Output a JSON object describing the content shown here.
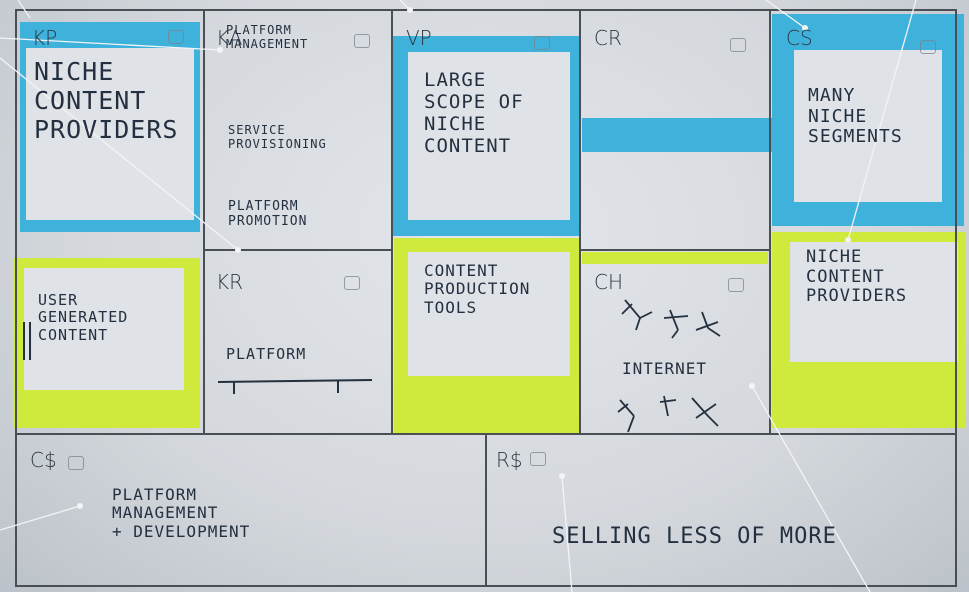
{
  "blocks": {
    "kp": {
      "code": "KP",
      "note": "Niche\nContent\nProviders"
    },
    "ka": {
      "code": "KA",
      "notes": [
        "Platform\nmanagement",
        "Service\nprovisioning",
        "Platform\npromotion"
      ]
    },
    "kr": {
      "code": "KR",
      "note": "Platform"
    },
    "vp": {
      "code": "VP",
      "notes": [
        "Large\nscope of\nniche\ncontent",
        "Content\nproduction\ntools"
      ]
    },
    "cr": {
      "code": "CR"
    },
    "ch": {
      "code": "CH",
      "note": "Internet"
    },
    "cs": {
      "code": "CS",
      "notes": [
        "Many\nniche\nsegments",
        "Niche\ncontent\nproviders"
      ]
    },
    "cost": {
      "code": "C$",
      "note": "Platform\nmanagement\n+ development"
    },
    "revenue": {
      "code": "R$",
      "note": "Selling less of MORE"
    },
    "user_generated": {
      "note": "User\ngenerated\ncontent"
    }
  },
  "colors": {
    "blue": "#3fb2dc",
    "lime": "#cfea3c",
    "ink": "#24303f",
    "grid": "#4a4f56"
  }
}
